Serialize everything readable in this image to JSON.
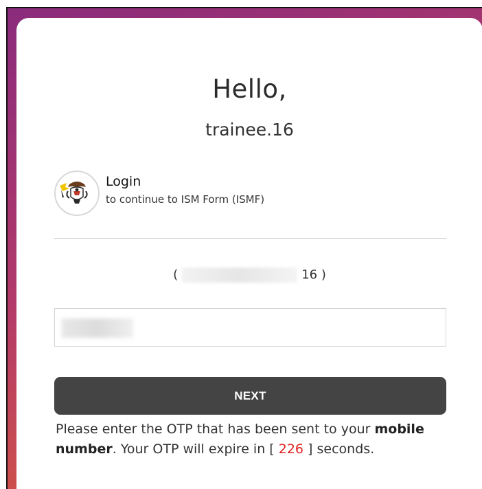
{
  "greeting": {
    "hello": "Hello,",
    "username": "trainee.16"
  },
  "login": {
    "title": "Login",
    "subtitle": "to continue to ISM Form (ISMF)",
    "logo_icon": "emblem-logo-icon"
  },
  "identity": {
    "open": "(",
    "suffix": "16 )"
  },
  "otp": {
    "input_placeholder": ""
  },
  "next_button": {
    "label": "NEXT"
  },
  "message": {
    "part1": "Please enter the OTP that has been sent to your ",
    "bold": "mobile number",
    "part2": ". Your OTP will expire in [ ",
    "seconds": "226",
    "part3": " ] seconds."
  },
  "colors": {
    "button_bg": "#444444",
    "timer": "#e02020",
    "gradient_start": "#8a2b7c",
    "gradient_end": "#e06a3a"
  }
}
